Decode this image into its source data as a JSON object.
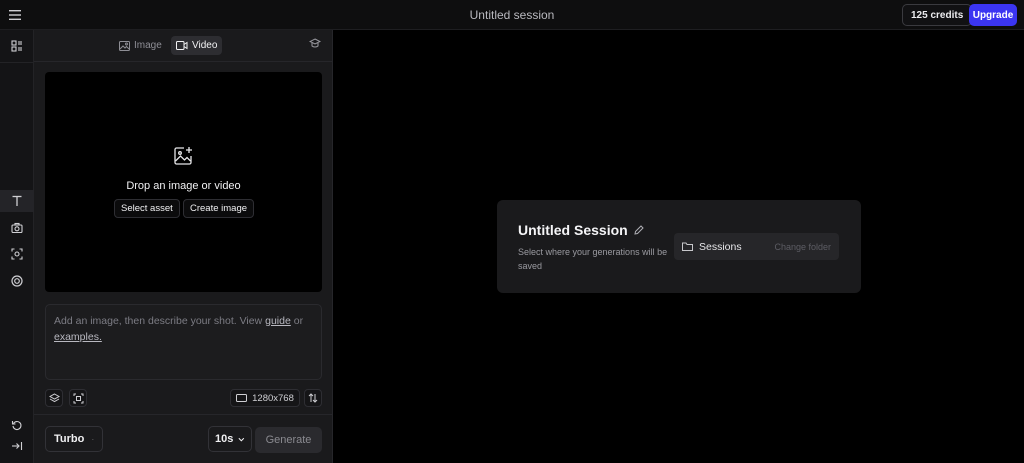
{
  "topbar": {
    "title": "Untitled session",
    "credits": "125 credits",
    "upgrade": "Upgrade"
  },
  "tabs": {
    "image": "Image",
    "video": "Video"
  },
  "drop": {
    "text": "Drop an image or video",
    "select_asset": "Select asset",
    "create_image": "Create image"
  },
  "prompt": {
    "text_before": "Add an image, then describe your shot. View ",
    "guide": "guide",
    "or": " or",
    "examples": "examples."
  },
  "tools": {
    "resolution": "1280x768"
  },
  "footer": {
    "model": "Turbo",
    "duration": "10s",
    "generate": "Generate"
  },
  "session": {
    "title": "Untitled Session",
    "subtitle": "Select where your generations will be saved",
    "folder": "Sessions",
    "change_folder": "Change folder"
  },
  "colors": {
    "accent": "#3b35f2",
    "background": "#000000",
    "panel": "#1a1a1c"
  }
}
